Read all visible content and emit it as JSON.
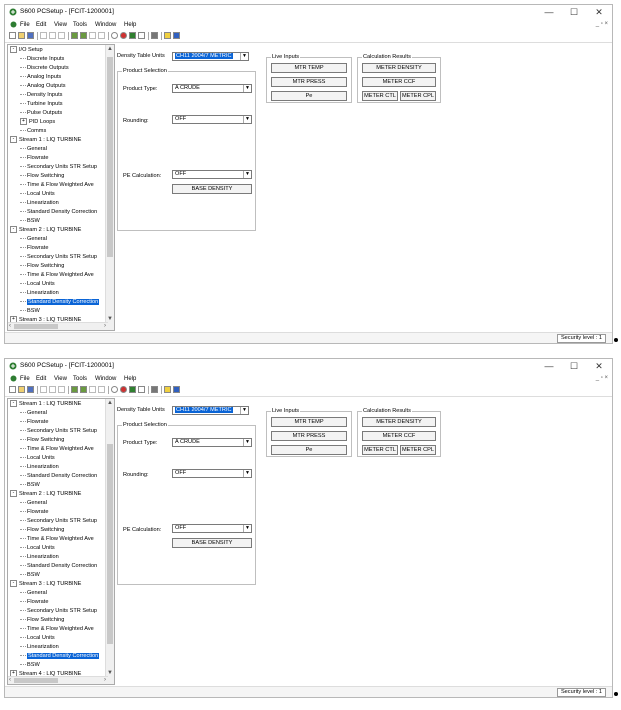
{
  "screens": [
    {
      "title": "S600 PCSetup  - [FCIT-1200001]",
      "tree": [
        {
          "label": "I/O Setup",
          "level": 0,
          "exp": "-"
        },
        {
          "label": "Discrete Inputs",
          "level": 1
        },
        {
          "label": "Discrete Outputs",
          "level": 1
        },
        {
          "label": "Analog Inputs",
          "level": 1
        },
        {
          "label": "Analog Outputs",
          "level": 1
        },
        {
          "label": "Density Inputs",
          "level": 1
        },
        {
          "label": "Turbine Inputs",
          "level": 1
        },
        {
          "label": "Pulse Outputs",
          "level": 1
        },
        {
          "label": "PID Loops",
          "level": 1,
          "exp": "+"
        },
        {
          "label": "Comms",
          "level": 1
        },
        {
          "label": "Stream 1 : LIQ TURBINE",
          "level": 0,
          "exp": "-"
        },
        {
          "label": "General",
          "level": 1
        },
        {
          "label": "Flowrate",
          "level": 1
        },
        {
          "label": "Secondary Units STR Setup",
          "level": 1
        },
        {
          "label": "Flow Switching",
          "level": 1
        },
        {
          "label": "Time & Flow Weighted Ave",
          "level": 1
        },
        {
          "label": "Local Units",
          "level": 1
        },
        {
          "label": "Linearization",
          "level": 1
        },
        {
          "label": "Standard Density Correction",
          "level": 1
        },
        {
          "label": "BSW",
          "level": 1
        },
        {
          "label": "Stream 2 : LIQ TURBINE",
          "level": 0,
          "exp": "-"
        },
        {
          "label": "General",
          "level": 1
        },
        {
          "label": "Flowrate",
          "level": 1
        },
        {
          "label": "Secondary Units STR Setup",
          "level": 1
        },
        {
          "label": "Flow Switching",
          "level": 1
        },
        {
          "label": "Time & Flow Weighted Ave",
          "level": 1
        },
        {
          "label": "Local Units",
          "level": 1
        },
        {
          "label": "Linearization",
          "level": 1
        },
        {
          "label": "Standard Density Correction",
          "level": 1,
          "selected": true
        },
        {
          "label": "BSW",
          "level": 1
        },
        {
          "label": "Stream 3 : LIQ TURBINE",
          "level": 0,
          "exp": "+"
        }
      ]
    },
    {
      "title": "S600 PCSetup  - [FCIT-1200001]",
      "tree": [
        {
          "label": "Stream 1 : LIQ TURBINE",
          "level": 0,
          "exp": "-"
        },
        {
          "label": "General",
          "level": 1
        },
        {
          "label": "Flowrate",
          "level": 1
        },
        {
          "label": "Secondary Units STR Setup",
          "level": 1
        },
        {
          "label": "Flow Switching",
          "level": 1
        },
        {
          "label": "Time & Flow Weighted Ave",
          "level": 1
        },
        {
          "label": "Local Units",
          "level": 1
        },
        {
          "label": "Linearization",
          "level": 1
        },
        {
          "label": "Standard Density Correction",
          "level": 1
        },
        {
          "label": "BSW",
          "level": 1
        },
        {
          "label": "Stream 2 : LIQ TURBINE",
          "level": 0,
          "exp": "-"
        },
        {
          "label": "General",
          "level": 1
        },
        {
          "label": "Flowrate",
          "level": 1
        },
        {
          "label": "Secondary Units STR Setup",
          "level": 1
        },
        {
          "label": "Flow Switching",
          "level": 1
        },
        {
          "label": "Time & Flow Weighted Ave",
          "level": 1
        },
        {
          "label": "Local Units",
          "level": 1
        },
        {
          "label": "Linearization",
          "level": 1
        },
        {
          "label": "Standard Density Correction",
          "level": 1
        },
        {
          "label": "BSW",
          "level": 1
        },
        {
          "label": "Stream 3 : LIQ TURBINE",
          "level": 0,
          "exp": "-"
        },
        {
          "label": "General",
          "level": 1
        },
        {
          "label": "Flowrate",
          "level": 1
        },
        {
          "label": "Secondary Units STR Setup",
          "level": 1
        },
        {
          "label": "Flow Switching",
          "level": 1
        },
        {
          "label": "Time & Flow Weighted Ave",
          "level": 1
        },
        {
          "label": "Local Units",
          "level": 1
        },
        {
          "label": "Linearization",
          "level": 1
        },
        {
          "label": "Standard Density Correction",
          "level": 1,
          "selected": true
        },
        {
          "label": "BSW",
          "level": 1
        },
        {
          "label": "Stream 4 : LIQ TURBINE",
          "level": 0,
          "exp": "+"
        }
      ]
    }
  ],
  "menu": [
    "File",
    "Edit",
    "View",
    "Tools",
    "Window",
    "Help"
  ],
  "window_controls": {
    "minimize": "—",
    "maximize": "☐",
    "close": "✕"
  },
  "mdi_controls": "_ ▫ ×",
  "form": {
    "density_table_units_label": "Density Table Units",
    "density_table_units_value": "CH11 2004/7 METRIC",
    "product_selection_title": "Product Selection",
    "product_type_label": "Product Type:",
    "product_type_value": "A CRUDE",
    "rounding_label": "Rounding:",
    "rounding_value": "OFF",
    "pe_calc_label": "PE Calculation:",
    "pe_calc_value": "OFF",
    "base_density_button": "BASE DENSITY"
  },
  "live_inputs": {
    "title": "Live Inputs",
    "buttons": [
      "MTR TEMP",
      "MTR PRESS",
      "Pe"
    ]
  },
  "calc_results": {
    "title": "Calculation Results",
    "meter_density": "METER DENSITY",
    "meter_ccf": "METER CCF",
    "meter_ctl": "METER CTL",
    "meter_cpl": "METER CPL"
  },
  "status": {
    "security": "Security level : 1"
  },
  "colors": {
    "selection": "#0a64d6",
    "border": "#bfbfbf"
  }
}
